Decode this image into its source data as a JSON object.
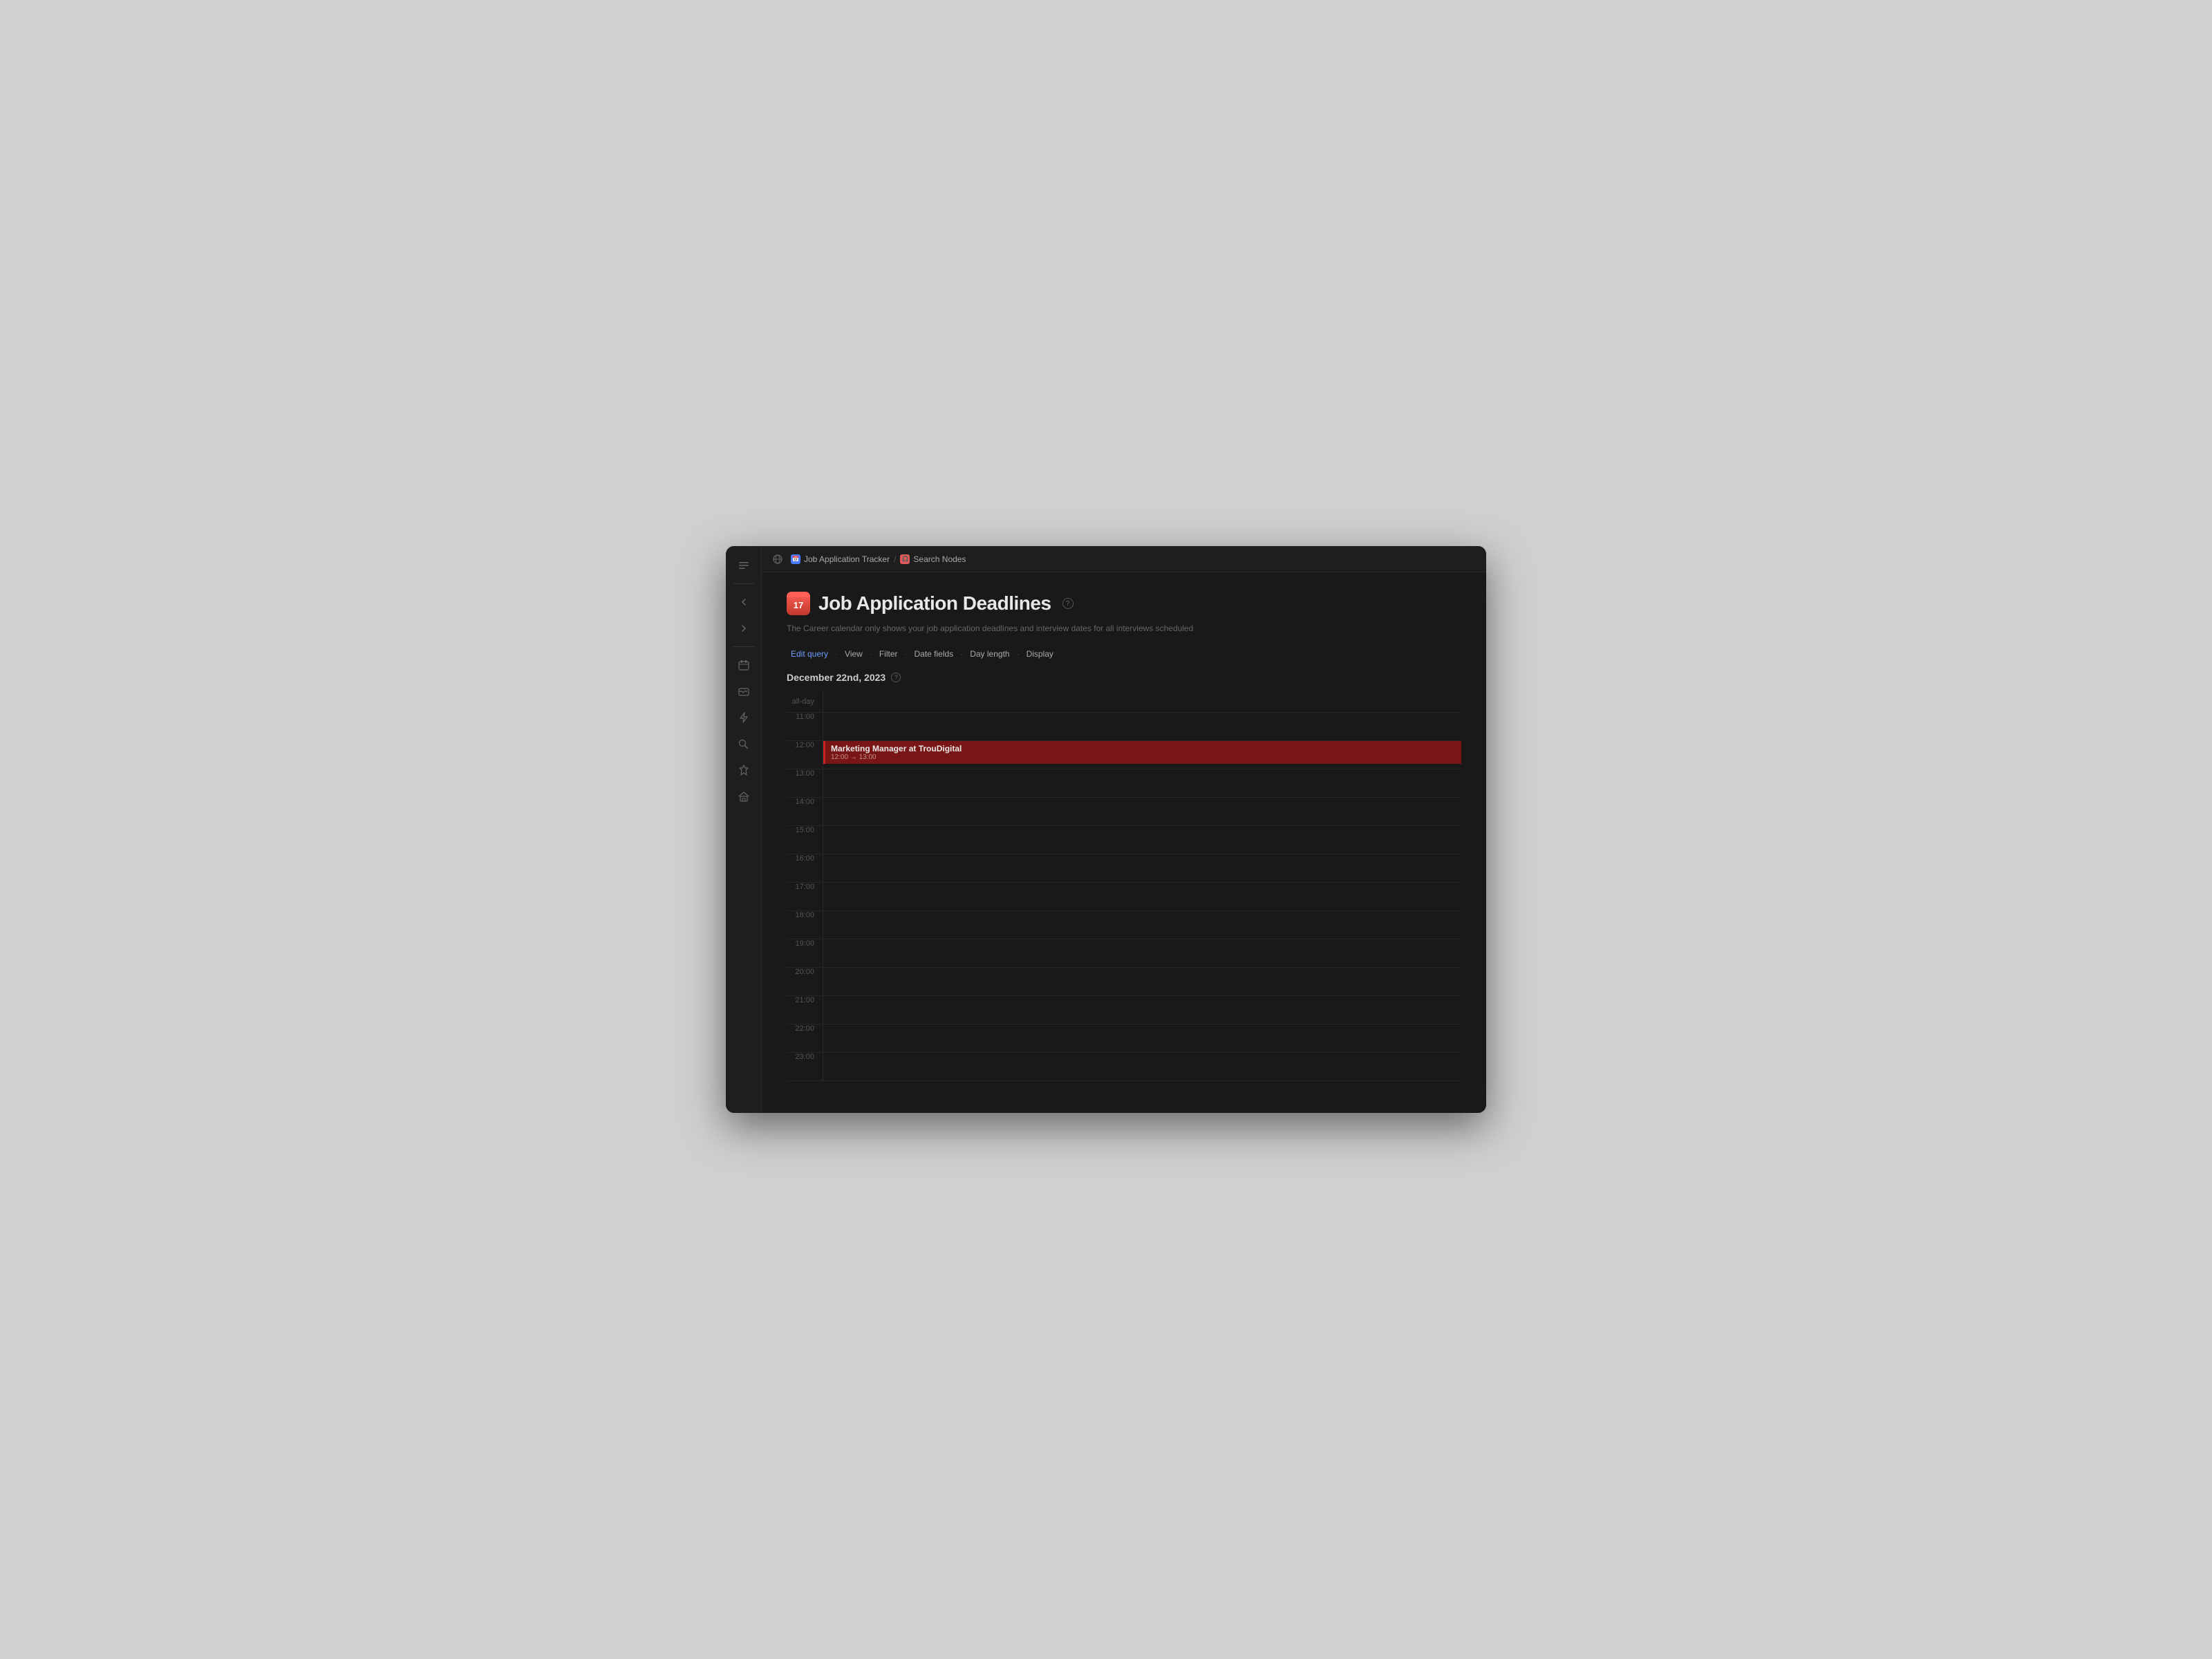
{
  "app": {
    "title": "Job Application Tracker"
  },
  "breadcrumb": {
    "home_icon": "🌐",
    "tracker_icon": "📅",
    "tracker_label": "Job Application Tracker",
    "separator": "/",
    "search_icon": "🎧",
    "search_label": "Search Nodes"
  },
  "page": {
    "icon_number": "17",
    "title": "Job Application Deadlines",
    "subtitle": "The Career calendar only shows your job application deadlines and interview dates for all interviews scheduled",
    "help_tooltip": "?"
  },
  "toolbar": {
    "edit_query": "Edit query",
    "view": "View",
    "filter": "Filter",
    "date_fields": "Date fields",
    "day_length": "Day length",
    "display": "Display"
  },
  "calendar": {
    "current_date": "December 22nd, 2023",
    "all_day_label": "all-day",
    "time_slots": [
      {
        "time": "11:00"
      },
      {
        "time": "12:00"
      },
      {
        "time": "13:00"
      },
      {
        "time": "14:00"
      },
      {
        "time": "15:00"
      },
      {
        "time": "16:00"
      },
      {
        "time": "17:00"
      },
      {
        "time": "18:00"
      },
      {
        "time": "19:00"
      },
      {
        "time": "20:00"
      },
      {
        "time": "21:00"
      },
      {
        "time": "22:00"
      },
      {
        "time": "23:00"
      }
    ],
    "event": {
      "title": "Marketing Manager at TrouDigital",
      "time_display": "12:00 → 13:00",
      "start": "12:00",
      "end": "13:00",
      "slot_index": 1,
      "color_bg": "#7a1515",
      "color_border": "#cc2222"
    }
  },
  "sidebar": {
    "icons": [
      {
        "name": "sidebar-toggle-icon",
        "symbol": "⊟",
        "label": "sidebar toggle"
      },
      {
        "name": "back-icon",
        "symbol": "←",
        "label": "back"
      },
      {
        "name": "forward-icon",
        "symbol": "→",
        "label": "forward"
      },
      {
        "name": "calendar-icon",
        "symbol": "📅",
        "label": "calendar"
      },
      {
        "name": "inbox-icon",
        "symbol": "✉",
        "label": "inbox"
      },
      {
        "name": "lightning-icon",
        "symbol": "⚡",
        "label": "quick add"
      },
      {
        "name": "search-icon",
        "symbol": "🔍",
        "label": "search"
      },
      {
        "name": "pin-icon",
        "symbol": "📌",
        "label": "pinned"
      },
      {
        "name": "home-icon",
        "symbol": "🏠",
        "label": "home"
      }
    ]
  }
}
